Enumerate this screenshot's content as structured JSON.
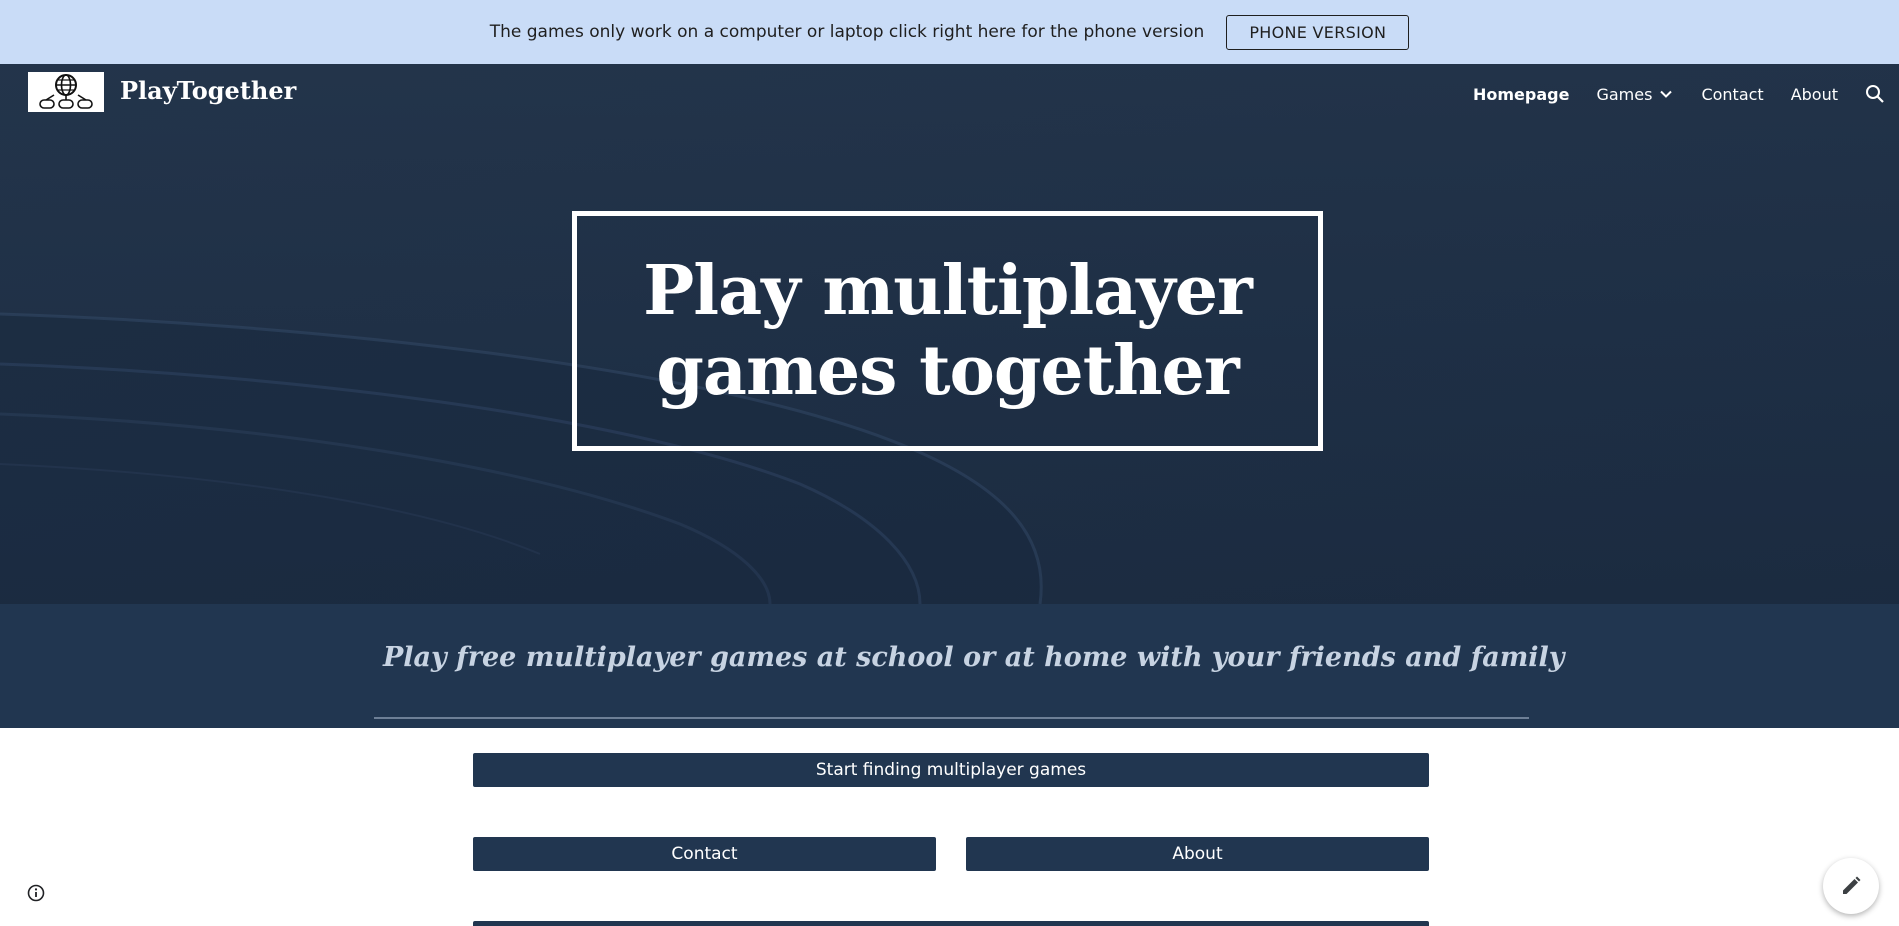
{
  "announcement": {
    "message": "The games only work on a computer or laptop click right here for the phone version",
    "button_label": "PHONE VERSION"
  },
  "header": {
    "logo_icon": "globe-controllers-icon",
    "site_title": "PlayTogether",
    "nav": {
      "homepage": "Homepage",
      "games": "Games",
      "contact": "Contact",
      "about": "About"
    },
    "search_icon": "search-icon"
  },
  "hero": {
    "title_line1": "Play multiplayer",
    "title_line2": "games together"
  },
  "subtitle": "Play free multiplayer games at school or at home with your friends and family",
  "buttons": {
    "start": "Start finding multiplayer games",
    "contact": "Contact",
    "about": "About"
  },
  "colors": {
    "announce_bg": "#c9dcf7",
    "hero_bg": "#1e2f45",
    "band_bg": "#213650",
    "button_bg": "#213650"
  },
  "icons": {
    "info": "info-icon",
    "edit": "pencil-icon"
  }
}
